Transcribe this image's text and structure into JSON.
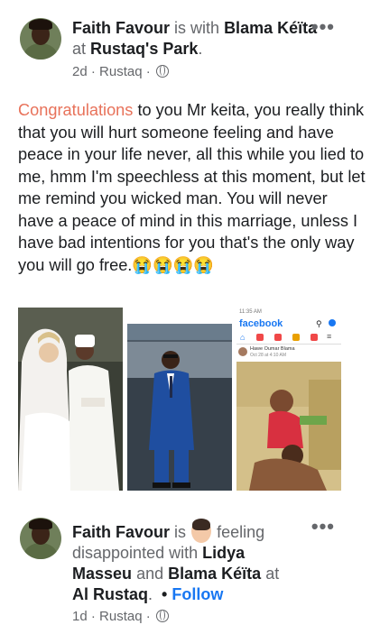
{
  "post1": {
    "author": "Faith Favour",
    "is_with": "is with",
    "tagged": "Blama Kéïta",
    "at": "at",
    "place": "Rustaq's Park",
    "period": ".",
    "time": "2d",
    "location": "Rustaq",
    "menu": "•••",
    "highlight": "Congratulations",
    "text": " to you Mr keita, you really think that you will hurt someone feeling and have peace in your life never, all this while you lied to me, hmm I'm speechless at this moment, but let me remind you wicked man. You will never have a peace of mind in this marriage, unless I have bad intentions for you that's the only way you will go free.",
    "emojis": "😭😭😭😭",
    "photo3": {
      "time": "11:35 AM",
      "app_title": "facebook",
      "item_name": "Hawe Oumar Blama",
      "item_meta": "Oct 28 at 4:10 AM"
    }
  },
  "post2": {
    "author": "Faith Favour",
    "is": "is",
    "feeling": "feeling disappointed with",
    "tag1": "Lidya Masseu",
    "and": "and",
    "tag2": "Blama Kéïta",
    "at": "at",
    "place": "Al Rustaq",
    "period": ".",
    "dot": "•",
    "follow": "Follow",
    "time": "1d",
    "location": "Rustaq",
    "menu": "•••"
  },
  "colors": {
    "highlight": "#e8725a",
    "link": "#1877f2",
    "meta": "#65676b",
    "fb_blue": "#1877f2"
  }
}
